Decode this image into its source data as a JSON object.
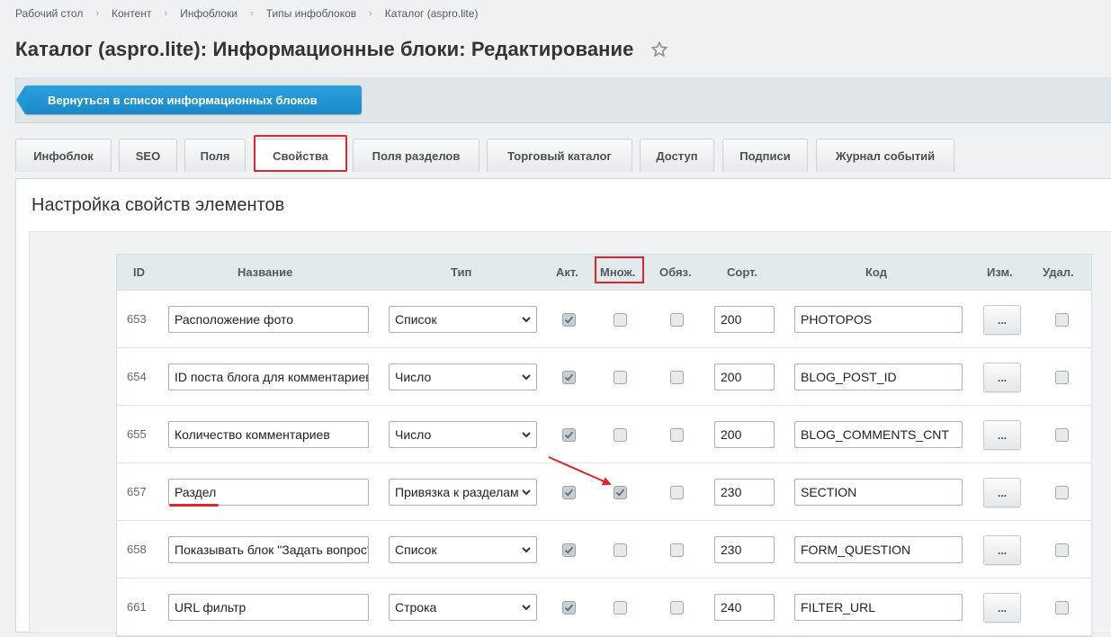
{
  "breadcrumb": [
    "Рабочий стол",
    "Контент",
    "Инфоблоки",
    "Типы инфоблоков",
    "Каталог (aspro.lite)"
  ],
  "title": "Каталог (aspro.lite): Информационные блоки: Редактирование",
  "back_button": "Вернуться в список информационных блоков",
  "tabs": [
    "Инфоблок",
    "SEO",
    "Поля",
    "Свойства",
    "Поля разделов",
    "Торговый каталог",
    "Доступ",
    "Подписи",
    "Журнал событий"
  ],
  "active_tab": "Свойства",
  "section_title": "Настройка свойств элементов",
  "columns": {
    "id": "ID",
    "name": "Название",
    "type": "Тип",
    "active": "Акт.",
    "multiple": "Множ.",
    "required": "Обяз.",
    "sort": "Сорт.",
    "code": "Код",
    "edit": "Изм.",
    "delete": "Удал."
  },
  "edit_label": "...",
  "rows": [
    {
      "id": "653",
      "name": "Расположение фото",
      "type": "Список",
      "active": true,
      "multiple": false,
      "required": false,
      "sort": "200",
      "code": "PHOTOPOS",
      "delete": false
    },
    {
      "id": "654",
      "name": "ID поста блога для комментариев",
      "type": "Число",
      "active": true,
      "multiple": false,
      "required": false,
      "sort": "200",
      "code": "BLOG_POST_ID",
      "delete": false
    },
    {
      "id": "655",
      "name": "Количество комментариев",
      "type": "Число",
      "active": true,
      "multiple": false,
      "required": false,
      "sort": "200",
      "code": "BLOG_COMMENTS_CNT",
      "delete": false
    },
    {
      "id": "657",
      "name": "Раздел",
      "type": "Привязка к разделам",
      "active": true,
      "multiple": true,
      "required": false,
      "sort": "230",
      "code": "SECTION",
      "delete": false
    },
    {
      "id": "658",
      "name": "Показывать блок \"Задать вопрос\"",
      "type": "Список",
      "active": true,
      "multiple": false,
      "required": false,
      "sort": "230",
      "code": "FORM_QUESTION",
      "delete": false
    },
    {
      "id": "661",
      "name": "URL фильтр",
      "type": "Строка",
      "active": true,
      "multiple": false,
      "required": false,
      "sort": "240",
      "code": "FILTER_URL",
      "delete": false
    }
  ],
  "colors": {
    "accent": "#1a89c9",
    "highlight": "#e0262b"
  }
}
